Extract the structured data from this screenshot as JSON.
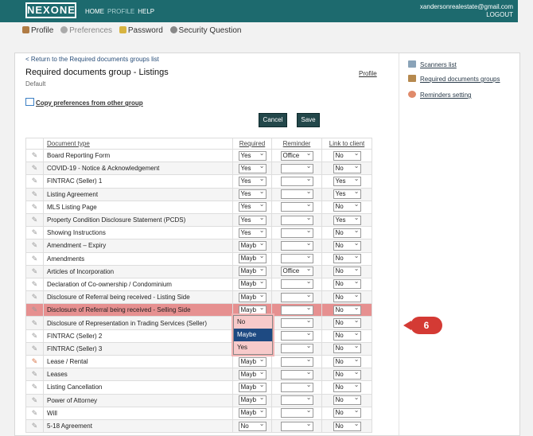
{
  "brand": "NEXONE",
  "topnav": [
    {
      "label": "HOME",
      "active": true
    },
    {
      "label": "PROFILE",
      "active": false
    },
    {
      "label": "HELP",
      "active": true
    }
  ],
  "user": {
    "email": "xandersonrealestate@gmail.com",
    "logout": "LOGOUT"
  },
  "subnav": [
    {
      "label": "Profile",
      "icon": "person-icon"
    },
    {
      "label": "Preferences",
      "icon": "gear-icon"
    },
    {
      "label": "Password",
      "icon": "key-icon"
    },
    {
      "label": "Security Question",
      "icon": "gear-icon"
    }
  ],
  "panel": {
    "back_link": "< Return to the Required documents groups list",
    "title": "Required documents group - Listings",
    "subtitle": "Default",
    "profile_link": "Profile",
    "copy_link": "Copy preferences from other group",
    "cancel": "Cancel",
    "save": "Save"
  },
  "right_links": [
    "Scanners list",
    "Required documents groups",
    "Reminders setting"
  ],
  "table": {
    "headers": [
      "Document type",
      "Required",
      "Reminder",
      "Link to client"
    ],
    "rows": [
      {
        "name": "Board Reporting Form",
        "required": "Yes",
        "reminder": "Office",
        "link": "No"
      },
      {
        "name": "COVID-19 - Notice & Acknowledgement",
        "required": "Yes",
        "reminder": "",
        "link": "No"
      },
      {
        "name": "FINTRAC (Seller) 1",
        "required": "Yes",
        "reminder": "",
        "link": "Yes"
      },
      {
        "name": "Listing Agreement",
        "required": "Yes",
        "reminder": "",
        "link": "Yes"
      },
      {
        "name": "MLS Listing Page",
        "required": "Yes",
        "reminder": "",
        "link": "No"
      },
      {
        "name": "Property Condition Disclosure Statement (PCDS)",
        "required": "Yes",
        "reminder": "",
        "link": "Yes"
      },
      {
        "name": "Showing Instructions",
        "required": "Yes",
        "reminder": "",
        "link": "No"
      },
      {
        "name": "Amendment – Expiry",
        "required": "Mayb",
        "reminder": "",
        "link": "No"
      },
      {
        "name": "Amendments",
        "required": "Mayb",
        "reminder": "",
        "link": "No"
      },
      {
        "name": "Articles of Incorporation",
        "required": "Mayb",
        "reminder": "Office",
        "link": "No"
      },
      {
        "name": "Declaration of Co-ownership / Condominium",
        "required": "Mayb",
        "reminder": "",
        "link": "No"
      },
      {
        "name": "Disclosure of Referral being received - Listing Side",
        "required": "Mayb",
        "reminder": "",
        "link": "No"
      },
      {
        "name": "Disclosure of Referral being received - Selling Side",
        "required": "Mayb",
        "reminder": "",
        "link": "No",
        "highlight": true
      },
      {
        "name": "Disclosure of Representation in Trading Services (Seller)",
        "required": "",
        "reminder": "",
        "link": "No"
      },
      {
        "name": "FINTRAC (Seller) 2",
        "required": "",
        "reminder": "",
        "link": "No"
      },
      {
        "name": "FINTRAC (Seller) 3",
        "required": "",
        "reminder": "",
        "link": "No"
      },
      {
        "name": "Lease / Rental",
        "required": "Mayb",
        "reminder": "",
        "link": "No",
        "icon_color": "#d9764a"
      },
      {
        "name": "Leases",
        "required": "Mayb",
        "reminder": "",
        "link": "No"
      },
      {
        "name": "Listing Cancellation",
        "required": "Mayb",
        "reminder": "",
        "link": "No"
      },
      {
        "name": "Power of Attorney",
        "required": "Mayb",
        "reminder": "",
        "link": "No"
      },
      {
        "name": "Will",
        "required": "Mayb",
        "reminder": "",
        "link": "No"
      },
      {
        "name": "5-18 Agreement",
        "required": "No",
        "reminder": "",
        "link": "No"
      }
    ]
  },
  "dropdown": {
    "options": [
      "No",
      "Maybe",
      "Yes"
    ],
    "selected": "Maybe"
  },
  "callout": "6"
}
